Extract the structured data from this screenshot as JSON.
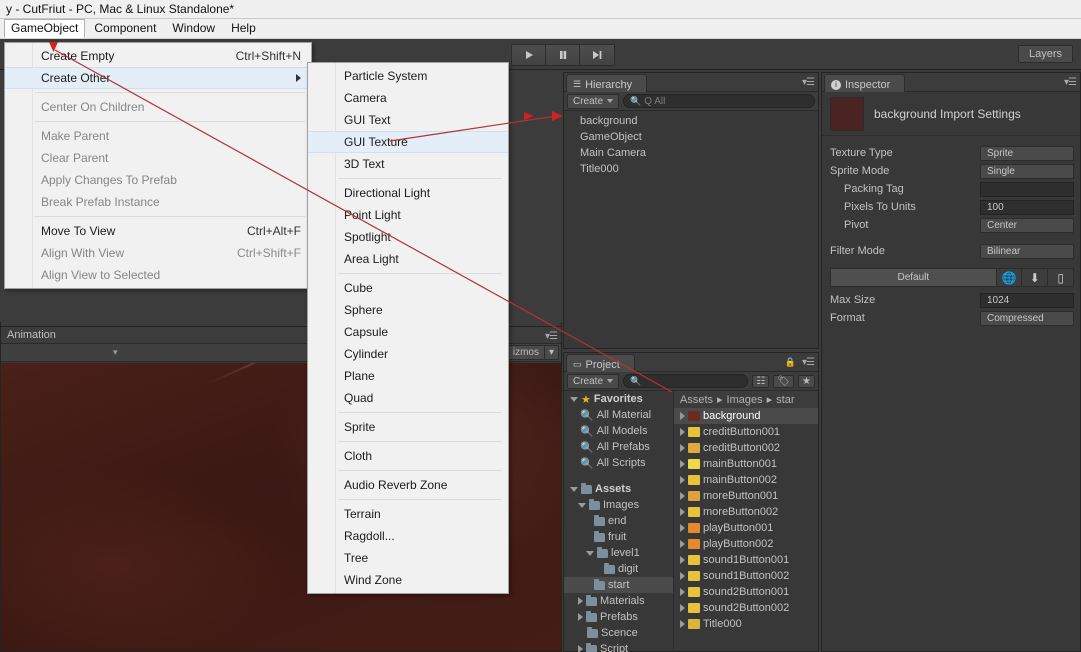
{
  "window": {
    "title": "y - CutFriut - PC, Mac & Linux Standalone*"
  },
  "menubar": {
    "items": [
      {
        "label": "GameObject",
        "active": true
      },
      {
        "label": "Component",
        "active": false
      },
      {
        "label": "Window",
        "active": false
      },
      {
        "label": "Help",
        "active": false
      }
    ]
  },
  "toolbar": {
    "play_icon": "play-icon",
    "pause_icon": "pause-icon",
    "step_icon": "step-icon",
    "layers_label": "Layers"
  },
  "gameobject_menu": {
    "items": [
      {
        "label": "Create Empty",
        "shortcut": "Ctrl+Shift+N",
        "state": "normal",
        "submenu": false
      },
      {
        "label": "Create Other",
        "shortcut": "",
        "state": "highlighted",
        "submenu": true
      },
      {
        "sep": true
      },
      {
        "label": "Center On Children",
        "shortcut": "",
        "state": "disabled",
        "submenu": false
      },
      {
        "sep": true
      },
      {
        "label": "Make Parent",
        "shortcut": "",
        "state": "disabled",
        "submenu": false
      },
      {
        "label": "Clear Parent",
        "shortcut": "",
        "state": "disabled",
        "submenu": false
      },
      {
        "label": "Apply Changes To Prefab",
        "shortcut": "",
        "state": "disabled",
        "submenu": false
      },
      {
        "label": "Break Prefab Instance",
        "shortcut": "",
        "state": "disabled",
        "submenu": false
      },
      {
        "sep": true
      },
      {
        "label": "Move To View",
        "shortcut": "Ctrl+Alt+F",
        "state": "normal",
        "submenu": false
      },
      {
        "label": "Align With View",
        "shortcut": "Ctrl+Shift+F",
        "state": "disabled",
        "submenu": false
      },
      {
        "label": "Align View to Selected",
        "shortcut": "",
        "state": "disabled",
        "submenu": false
      }
    ]
  },
  "create_other_menu": {
    "items": [
      {
        "label": "Particle System",
        "state": "normal"
      },
      {
        "label": "Camera",
        "state": "normal"
      },
      {
        "label": "GUI Text",
        "state": "normal"
      },
      {
        "label": "GUI Texture",
        "state": "highlighted"
      },
      {
        "label": "3D Text",
        "state": "normal"
      },
      {
        "sep": true
      },
      {
        "label": "Directional Light",
        "state": "normal"
      },
      {
        "label": "Point Light",
        "state": "normal"
      },
      {
        "label": "Spotlight",
        "state": "normal"
      },
      {
        "label": "Area Light",
        "state": "normal"
      },
      {
        "sep": true
      },
      {
        "label": "Cube",
        "state": "normal"
      },
      {
        "label": "Sphere",
        "state": "normal"
      },
      {
        "label": "Capsule",
        "state": "normal"
      },
      {
        "label": "Cylinder",
        "state": "normal"
      },
      {
        "label": "Plane",
        "state": "normal"
      },
      {
        "label": "Quad",
        "state": "normal"
      },
      {
        "sep": true
      },
      {
        "label": "Sprite",
        "state": "normal"
      },
      {
        "sep": true
      },
      {
        "label": "Cloth",
        "state": "normal"
      },
      {
        "sep": true
      },
      {
        "label": "Audio Reverb Zone",
        "state": "normal"
      },
      {
        "sep": true
      },
      {
        "label": "Terrain",
        "state": "normal"
      },
      {
        "label": "Ragdoll...",
        "state": "normal"
      },
      {
        "label": "Tree",
        "state": "normal"
      },
      {
        "label": "Wind Zone",
        "state": "normal"
      }
    ]
  },
  "hierarchy": {
    "tab_label": "Hierarchy",
    "create_label": "Create",
    "search_placeholder": "Q All",
    "items": [
      {
        "label": "background",
        "annotated": true
      },
      {
        "label": "GameObject",
        "annotated": false
      },
      {
        "label": "Main Camera",
        "annotated": false
      },
      {
        "label": "Title000",
        "annotated": false
      }
    ]
  },
  "inspector": {
    "tab_label": "Inspector",
    "title": "background Import Settings",
    "rows": [
      {
        "label": "Texture Type",
        "value": "Sprite",
        "type": "popup",
        "indent": false
      },
      {
        "label": "Sprite Mode",
        "value": "Single",
        "type": "popup",
        "indent": false
      },
      {
        "label": "Packing Tag",
        "value": "",
        "type": "text",
        "indent": true
      },
      {
        "label": "Pixels To Units",
        "value": "100",
        "type": "text",
        "indent": true
      },
      {
        "label": "Pivot",
        "value": "Center",
        "type": "popup",
        "indent": true
      },
      {
        "label": "",
        "value": "",
        "type": "spacer",
        "indent": false
      },
      {
        "label": "Filter Mode",
        "value": "Bilinear",
        "type": "popup",
        "indent": false
      }
    ],
    "platform_tab": "Default",
    "platform_icons": [
      "globe-icon",
      "download-icon",
      "device-icon"
    ],
    "override_rows": [
      {
        "label": "Max Size",
        "value": "1024"
      },
      {
        "label": "Format",
        "value": "Compressed"
      }
    ]
  },
  "project": {
    "tab_label": "Project",
    "create_label": "Create",
    "search_placeholder": "",
    "breadcrumb": [
      "Assets",
      "Images",
      "star"
    ],
    "favorites_label": "Favorites",
    "favorites": [
      {
        "label": "All Material"
      },
      {
        "label": "All Models"
      },
      {
        "label": "All Prefabs"
      },
      {
        "label": "All Scripts"
      }
    ],
    "assets_label": "Assets",
    "tree": [
      {
        "label": "Images",
        "depth": 1,
        "state": "open",
        "selected": false
      },
      {
        "label": "end",
        "depth": 2,
        "state": "leaf",
        "selected": false
      },
      {
        "label": "fruit",
        "depth": 2,
        "state": "leaf",
        "selected": false
      },
      {
        "label": "level1",
        "depth": 2,
        "state": "open",
        "selected": false
      },
      {
        "label": "digit",
        "depth": 3,
        "state": "leaf",
        "selected": false
      },
      {
        "label": "start",
        "depth": 2,
        "state": "leaf",
        "selected": true
      },
      {
        "label": "Materials",
        "depth": 1,
        "state": "closed",
        "selected": false
      },
      {
        "label": "Prefabs",
        "depth": 1,
        "state": "closed",
        "selected": false
      },
      {
        "label": "Scence",
        "depth": 1,
        "state": "leaf",
        "selected": false
      },
      {
        "label": "Script",
        "depth": 1,
        "state": "closed",
        "selected": false
      }
    ],
    "assets": [
      {
        "label": "background",
        "color": "#6b2a22",
        "selected": true
      },
      {
        "label": "creditButton001",
        "color": "#e8c23a",
        "selected": false
      },
      {
        "label": "creditButton002",
        "color": "#e2a93c",
        "selected": false
      },
      {
        "label": "mainButton001",
        "color": "#efd84a",
        "selected": false
      },
      {
        "label": "mainButton002",
        "color": "#e8c23a",
        "selected": false
      },
      {
        "label": "moreButton001",
        "color": "#dda23a",
        "selected": false
      },
      {
        "label": "moreButton002",
        "color": "#e8c23a",
        "selected": false
      },
      {
        "label": "playButton001",
        "color": "#e58a2a",
        "selected": false
      },
      {
        "label": "playButton002",
        "color": "#e58a2a",
        "selected": false
      },
      {
        "label": "sound1Button001",
        "color": "#e8c23a",
        "selected": false
      },
      {
        "label": "sound1Button002",
        "color": "#e8c23a",
        "selected": false
      },
      {
        "label": "sound2Button001",
        "color": "#e8c23a",
        "selected": false
      },
      {
        "label": "sound2Button002",
        "color": "#e8c23a",
        "selected": false
      },
      {
        "label": "Title000",
        "color": "#d8b43a",
        "selected": false
      }
    ]
  },
  "animation": {
    "tab_label": "Animation"
  },
  "gameview": {
    "gizmos_label": "izmos"
  },
  "annotations": {
    "arrow_color": "#d42020",
    "line_color": "#b43232"
  }
}
